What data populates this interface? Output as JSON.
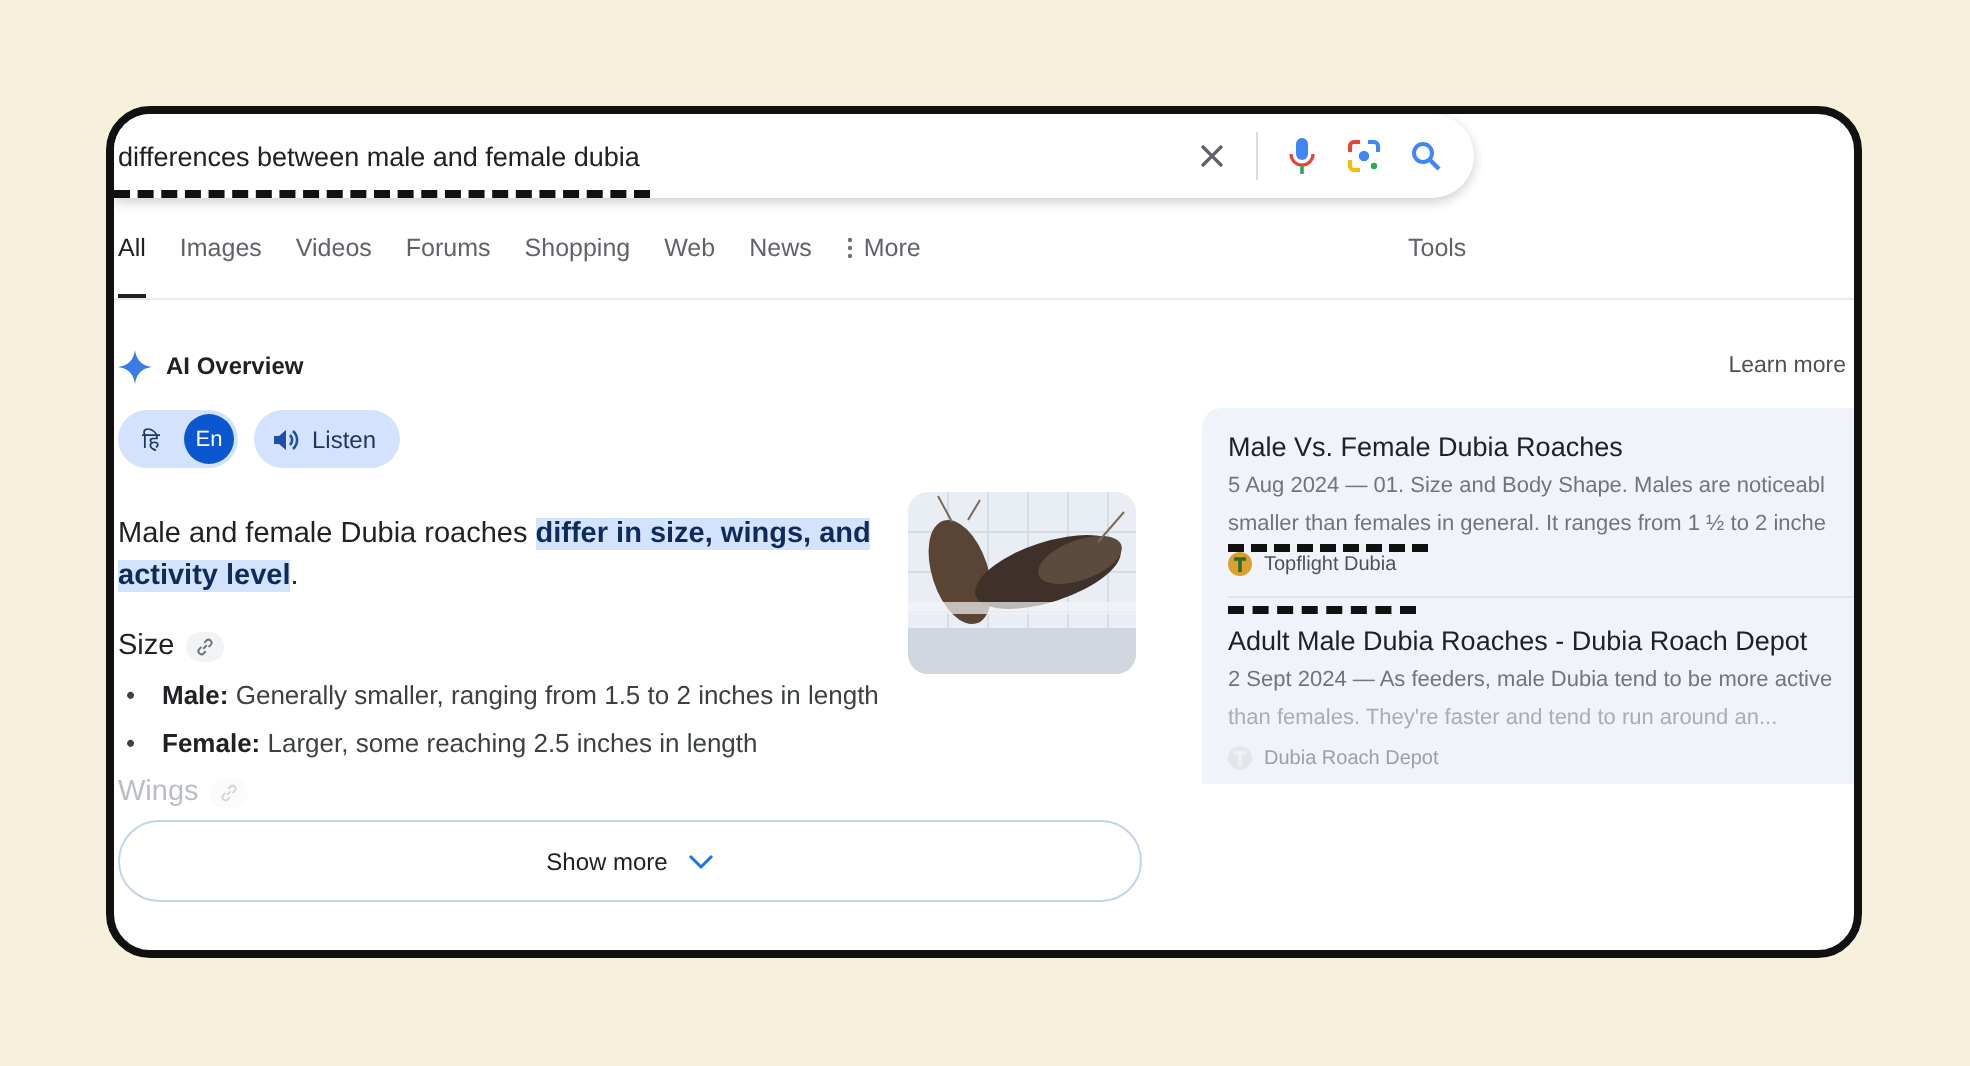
{
  "search": {
    "value": "differences between male and female dubia"
  },
  "tabs": [
    {
      "label": "All",
      "selected": true
    },
    {
      "label": "Images",
      "selected": false
    },
    {
      "label": "Videos",
      "selected": false
    },
    {
      "label": "Forums",
      "selected": false
    },
    {
      "label": "Shopping",
      "selected": false
    },
    {
      "label": "Web",
      "selected": false
    },
    {
      "label": "News",
      "selected": false
    },
    {
      "label": "More",
      "selected": false,
      "kind": "menu"
    }
  ],
  "tools": "Tools",
  "ai_overview": {
    "title": "AI Overview",
    "learn_more": "Learn more",
    "languages": [
      {
        "label": "हि",
        "selected": false
      },
      {
        "label": "En",
        "selected": true
      }
    ],
    "listen": "Listen",
    "summary": "Male and female Dubia roaches **differ in size, wings, and activity level**.",
    "sections": [
      {
        "heading": "Size",
        "faded": false,
        "bullets": [
          {
            "marker": "•",
            "text": "**Male:** Generally smaller, ranging from 1.5 to 2 inches in length"
          },
          {
            "marker": "•",
            "text": "**Female:** Larger, some reaching 2.5 inches in length"
          }
        ]
      },
      {
        "heading": "Wings",
        "faded": true
      }
    ],
    "show_more": "Show more"
  },
  "sources": [
    {
      "title": "Male Vs. Female Dubia Roaches",
      "snippet": "5 Aug 2024 — 01. Size and Body Shape. Males are noticeabl",
      "snippet_2": "smaller than females in general. It ranges from 1 ½ to 2 inche",
      "site": "Topflight Dubia",
      "faded": false
    },
    {
      "title": "Adult Male Dubia Roaches - Dubia Roach Depot",
      "snippet": "2 Sept 2024 — As feeders, male Dubia tend to be more active",
      "snippet_2": "than females. They're faster and tend to run around an...",
      "site": "Dubia Roach Depot",
      "faded": true
    }
  ]
}
